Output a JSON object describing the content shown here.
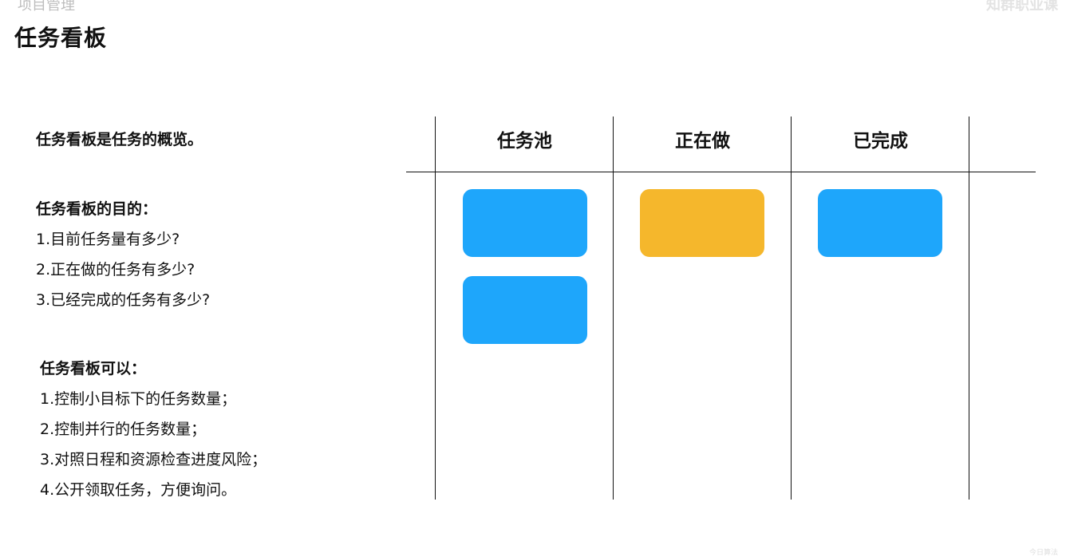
{
  "header": {
    "top_left": "项目管理",
    "top_right": "知群职业课",
    "title": "任务看板"
  },
  "intro": {
    "text": "任务看板是任务的概览。"
  },
  "purpose": {
    "heading": "任务看板的目的：",
    "items": [
      "1.目前任务量有多少?",
      "2.正在做的任务有多少?",
      "3.已经完成的任务有多少?"
    ]
  },
  "can_do": {
    "heading": "任务看板可以：",
    "items": [
      "1.控制小目标下的任务数量；",
      "2.控制并行的任务数量；",
      "3.对照日程和资源检查进度风险；",
      "4.公开领取任务，方便询问。"
    ]
  },
  "board": {
    "columns": [
      {
        "label": "任务池",
        "cards": 2,
        "card_color": "#1ea6fb"
      },
      {
        "label": "正在做",
        "cards": 1,
        "card_color": "#f5b72c"
      },
      {
        "label": "已完成",
        "cards": 1,
        "card_color": "#1ea6fb"
      }
    ]
  },
  "watermark": "今日算法"
}
